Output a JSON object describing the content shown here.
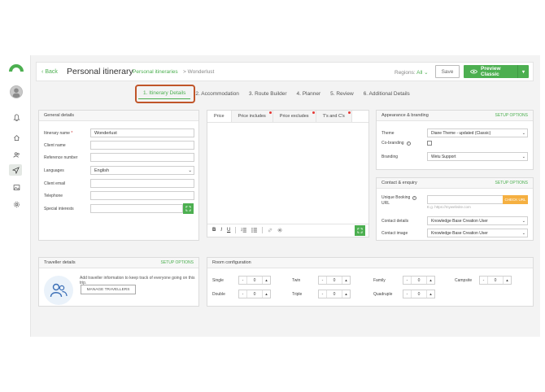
{
  "header": {
    "back": "Back",
    "title": "Personal itinerary",
    "breadcrumb_1": "Personal itineraries",
    "breadcrumb_sep": ">",
    "breadcrumb_2": "Wonderlust",
    "regions_label": "Regions:",
    "regions_value": "All",
    "save": "Save",
    "preview": "Preview Classic"
  },
  "steps": [
    {
      "label": "1. Itinerary Details"
    },
    {
      "label": "2. Accommodation"
    },
    {
      "label": "3. Route Builder"
    },
    {
      "label": "4. Planner"
    },
    {
      "label": "5. Review"
    },
    {
      "label": "6. Additional Details"
    }
  ],
  "general": {
    "title": "General details",
    "name_label": "Itinerary name",
    "name_req": "*",
    "name_value": "Wonderlust",
    "client_name_label": "Client name",
    "reference_label": "Reference number",
    "languages_label": "Languages",
    "languages_value": "English",
    "client_email_label": "Client email",
    "telephone_label": "Telephone",
    "special_label": "Special interests"
  },
  "price_tabs": [
    {
      "label": "Price"
    },
    {
      "label": "Price includes"
    },
    {
      "label": "Price excludes"
    },
    {
      "label": "T's and C's"
    }
  ],
  "toolbar": {
    "bold": "B",
    "italic": "I",
    "underline": "U"
  },
  "appearance": {
    "title": "Appearance & branding",
    "setup": "SETUP OPTIONS",
    "theme_label": "Theme",
    "theme_value": "Diane Theme - updated (Classic)",
    "cobranding_label": "Co-branding",
    "branding_label": "Branding",
    "branding_value": "Wetu Support"
  },
  "contact": {
    "title": "Contact & enquiry",
    "setup": "SETUP OPTIONS",
    "booking_label_1": "Unique Booking",
    "booking_label_2": "URL",
    "booking_placeholder": "E.g. https://mywebsite.com",
    "check_url": "CHECK URL",
    "details_label": "Contact details",
    "details_value": "Knowledge Base Creation User",
    "image_label": "Contact image",
    "image_value": "Knowledge Base Creation User"
  },
  "traveller": {
    "title": "Traveller details",
    "setup": "SETUP OPTIONS",
    "text": "Add traveller information to keep track of everyone going on this trip.",
    "button": "MANAGE TRAVELLERS"
  },
  "room": {
    "title": "Room configuration",
    "items": [
      {
        "label": "Single",
        "value": "0"
      },
      {
        "label": "Twin",
        "value": "0"
      },
      {
        "label": "Family",
        "value": "0"
      },
      {
        "label": "Campsite",
        "value": "0"
      },
      {
        "label": "Double",
        "value": "0"
      },
      {
        "label": "Triple",
        "value": "0"
      },
      {
        "label": "Quadruple",
        "value": "0"
      }
    ]
  },
  "colors": {
    "accent": "#4caf50",
    "highlight": "#c0552a",
    "warning": "#f5b041"
  }
}
